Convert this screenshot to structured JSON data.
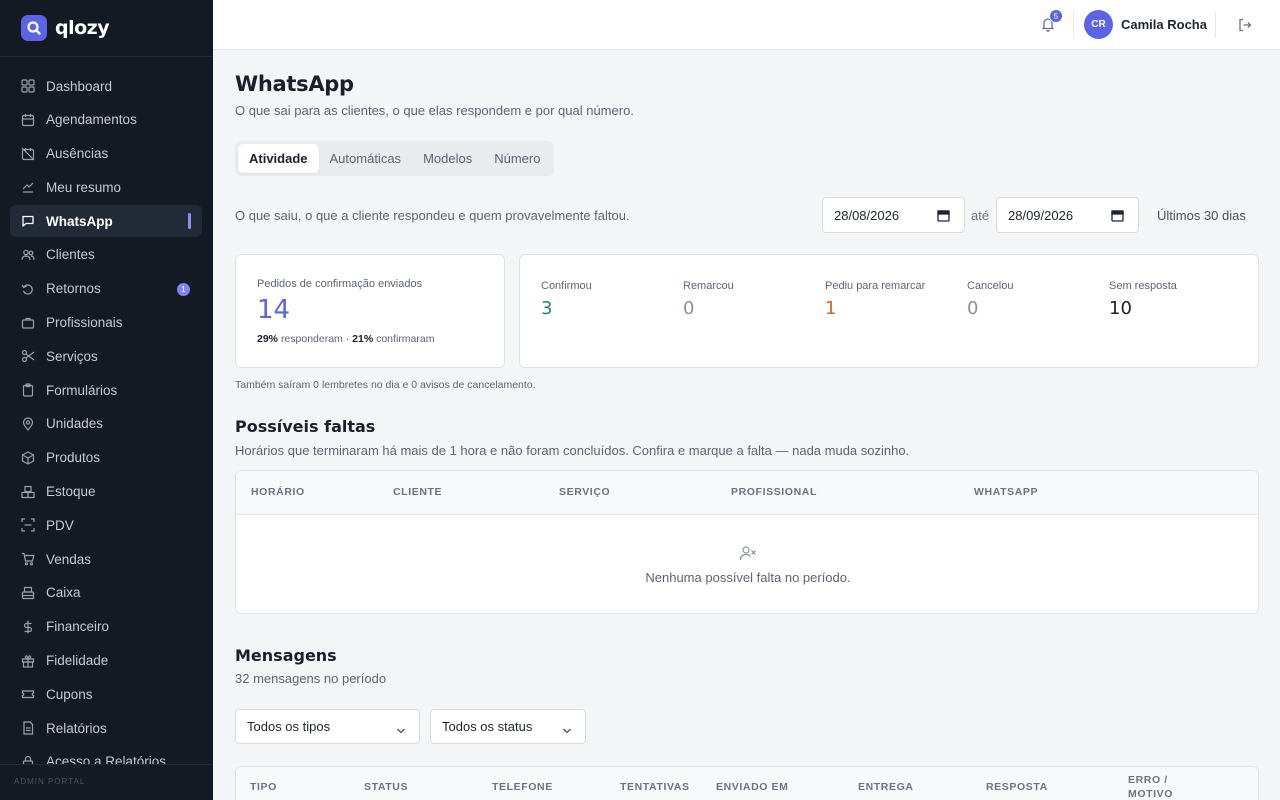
{
  "brand": {
    "name": "qlozy"
  },
  "sidebar": {
    "items": [
      {
        "label": "Dashboard",
        "icon": "dashboard-icon"
      },
      {
        "label": "Agendamentos",
        "icon": "calendar-icon"
      },
      {
        "label": "Ausências",
        "icon": "calendar-off-icon"
      },
      {
        "label": "Meu resumo",
        "icon": "summary-icon"
      },
      {
        "label": "WhatsApp",
        "icon": "chat-icon",
        "active": true
      },
      {
        "label": "Clientes",
        "icon": "clients-icon"
      },
      {
        "label": "Retornos",
        "icon": "returns-icon",
        "badge": "1"
      },
      {
        "label": "Profissionais",
        "icon": "briefcase-icon"
      },
      {
        "label": "Serviços",
        "icon": "scissors-icon"
      },
      {
        "label": "Formulários",
        "icon": "clipboard-icon"
      },
      {
        "label": "Unidades",
        "icon": "location-pin-icon"
      },
      {
        "label": "Produtos",
        "icon": "package-icon"
      },
      {
        "label": "Estoque",
        "icon": "boxes-icon"
      },
      {
        "label": "PDV",
        "icon": "scan-icon"
      },
      {
        "label": "Vendas",
        "icon": "cart-icon"
      },
      {
        "label": "Caixa",
        "icon": "cash-register-icon"
      },
      {
        "label": "Financeiro",
        "icon": "dollar-icon"
      },
      {
        "label": "Fidelidade",
        "icon": "gift-icon"
      },
      {
        "label": "Cupons",
        "icon": "ticket-icon"
      },
      {
        "label": "Relatórios",
        "icon": "report-icon"
      },
      {
        "label": "Acesso a Relatórios",
        "icon": "lock-icon"
      }
    ],
    "footer": "ADMIN PORTAL"
  },
  "topbar": {
    "notifications_count": "5",
    "user_initials": "CR",
    "user_name": "Camila Rocha"
  },
  "page": {
    "title": "WhatsApp",
    "subtitle": "O que sai para as clientes, o que elas respondem e por qual número.",
    "tabs": [
      {
        "label": "Atividade",
        "active": true
      },
      {
        "label": "Automáticas"
      },
      {
        "label": "Modelos"
      },
      {
        "label": "Número"
      }
    ],
    "filter_description": "O que saiu, o que a cliente respondeu e quem provavelmente faltou.",
    "date_from": "28/08/2026",
    "date_separator": "até",
    "date_to": "28/09/2026",
    "range_label": "Últimos 30 dias"
  },
  "summary": {
    "sent_label": "Pedidos de confirmação enviados",
    "sent_value": "14",
    "responded_pct": "29%",
    "responded_label": "responderam",
    "rate_separator": "·",
    "confirmed_pct": "21%",
    "confirmed_label": "confirmaram",
    "stats": [
      {
        "label": "Confirmou",
        "value": "3",
        "color": "#1f8a6a"
      },
      {
        "label": "Remarcou",
        "value": "0",
        "color": "#8a909b"
      },
      {
        "label": "Pediu para remarcar",
        "value": "1",
        "color": "#d2691e"
      },
      {
        "label": "Cancelou",
        "value": "0",
        "color": "#8a909b"
      },
      {
        "label": "Sem resposta",
        "value": "10",
        "color": "#1a1f2b"
      }
    ],
    "note": "Também saíram 0 lembretes no dia e 0 avisos de cancelamento."
  },
  "no_shows": {
    "title": "Possíveis faltas",
    "subtitle": "Horários que terminaram há mais de 1 hora e não foram concluídos. Confira e marque a falta — nada muda sozinho.",
    "columns": [
      "HORÁRIO",
      "CLIENTE",
      "SERVIÇO",
      "PROFISSIONAL",
      "WHATSAPP"
    ],
    "empty_text": "Nenhuma possível falta no período."
  },
  "messages": {
    "title": "Mensagens",
    "subtitle": "32 mensagens no período",
    "type_filter": "Todos os tipos",
    "status_filter": "Todos os status",
    "columns": [
      "TIPO",
      "STATUS",
      "TELEFONE",
      "TENTATIVAS",
      "ENVIADO EM",
      "ENTREGA",
      "RESPOSTA",
      "ERRO / MOTIVO"
    ]
  },
  "colors": {
    "accent": "#5b63e6",
    "sidebar_bg": "#141a24"
  }
}
